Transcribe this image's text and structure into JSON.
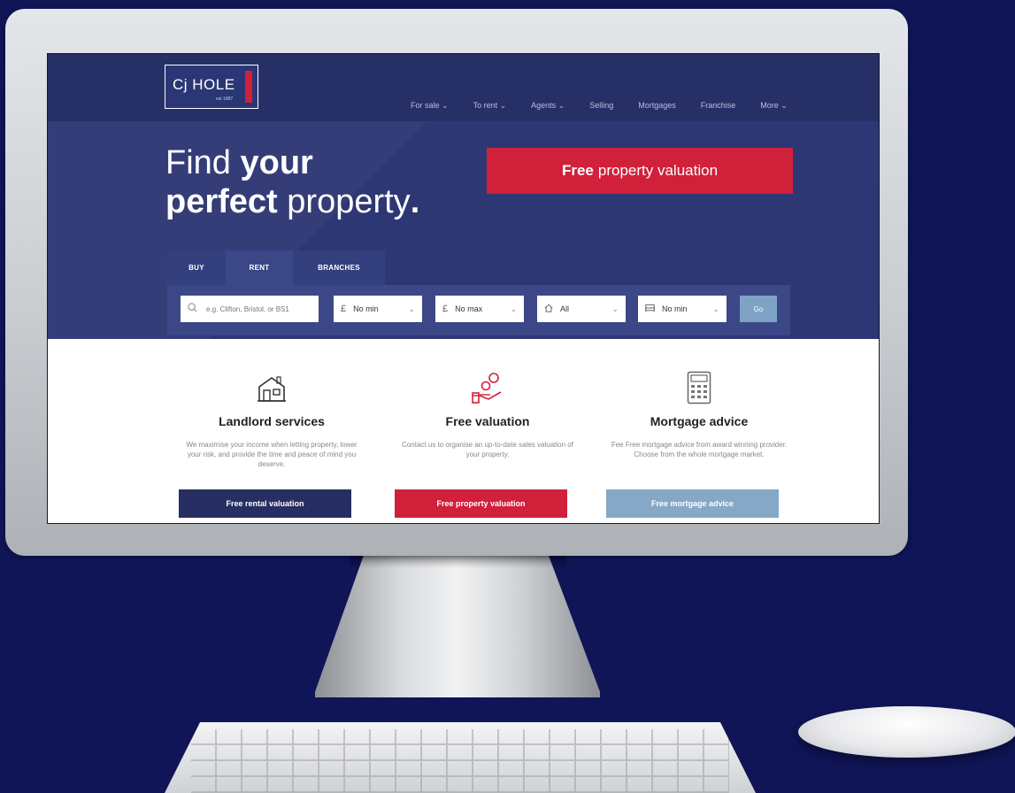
{
  "site": {
    "logo": {
      "text": "Cj HOLE",
      "subtext": "est 1887"
    },
    "nav": [
      "For sale ⌄",
      "To rent ⌄",
      "Agents ⌄",
      "Selling",
      "Mortgages",
      "Franchise",
      "More ⌄"
    ],
    "headline": {
      "part1": "Find ",
      "bold1": "your",
      "bold2": "perfect",
      "part2": " property",
      "dot": "."
    },
    "cta": {
      "bold": "Free",
      "rest": "property valuation"
    },
    "tabs": [
      "BUY",
      "RENT",
      "BRANCHES"
    ],
    "search": {
      "placeholder": "e.g. Clifton, Bristol, or BS1",
      "min_price": "No min",
      "max_price": "No max",
      "property_type": "All",
      "bedrooms": "No min",
      "go_label": "Go",
      "currency_symbol": "£"
    },
    "services": [
      {
        "title": "Landlord services",
        "desc": "We maximise your income when letting property, lower your risk, and provide the time and peace of mind you deserve.",
        "button": "Free rental valuation",
        "icon": "house-icon",
        "button_color": "#262e62"
      },
      {
        "title": "Free valuation",
        "desc": "Contact us to organise an up-to-date sales valuation of your property.",
        "button": "Free property valuation",
        "icon": "hand-coins-icon",
        "button_color": "#d1203a"
      },
      {
        "title": "Mortgage advice",
        "desc": "Fee Free mortgage advice from award winning provider. Choose from the whole mortgage market.",
        "button": "Free mortgage advice",
        "icon": "calculator-icon",
        "button_color": "#86a8c7"
      }
    ]
  },
  "colors": {
    "background": "#0f1556",
    "brand_navy": "#2d3773",
    "brand_red": "#d1203a",
    "accent_blue": "#86a8c7"
  }
}
